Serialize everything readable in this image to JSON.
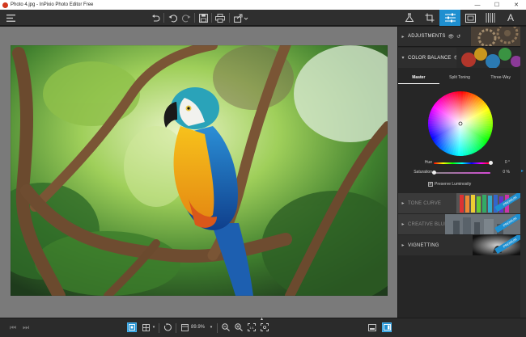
{
  "window": {
    "title": "Photo 4.jpg - InPixio Photo Editor Free",
    "minimize": "—",
    "maximize": "☐",
    "close": "✕"
  },
  "toolbar": {
    "menu_icon": "hamburger-icon",
    "undo_all_icon": "undo-all-icon",
    "undo_icon": "undo-icon",
    "redo_icon": "redo-icon",
    "save_icon": "save-icon",
    "print_icon": "print-icon",
    "share_icon": "share-icon",
    "tabs": [
      {
        "name": "flask-icon",
        "active": false
      },
      {
        "name": "crop-icon",
        "active": false
      },
      {
        "name": "sliders-icon",
        "active": true
      },
      {
        "name": "frame-icon",
        "active": false
      },
      {
        "name": "texture-icon",
        "active": false
      },
      {
        "name": "text-icon",
        "active": false
      }
    ],
    "text_tab_label": "A"
  },
  "panel": {
    "adjustments": {
      "label": "ADJUSTMENTS"
    },
    "color_balance": {
      "label": "COLOR BALANCE",
      "subtabs": [
        "Master",
        "Split Toning",
        "Three-Way"
      ],
      "active_subtab": "Master",
      "hue": {
        "label": "Hue",
        "value": "0 °",
        "fraction": 1.0
      },
      "saturation": {
        "label": "Saturation",
        "value": "0 %",
        "fraction": 0.0
      },
      "preserve_luminosity": {
        "label": "Preserve Luminosity",
        "checked": true
      }
    },
    "tone_curve": {
      "label": "TONE CURVE",
      "badge": "PREMIUM"
    },
    "creative_blur": {
      "label": "CREATIVE BLUR",
      "badge": "PREMIUM"
    },
    "vignetting": {
      "label": "VIGNETTING",
      "badge": "PREMIUM"
    }
  },
  "statusbar": {
    "zoom": "89.9%"
  },
  "colors": {
    "accent": "#1e8fd0",
    "toolbar_bg": "#2f2f2f",
    "panel_bg": "#262626",
    "canvas_bg": "#7a7a7a"
  }
}
